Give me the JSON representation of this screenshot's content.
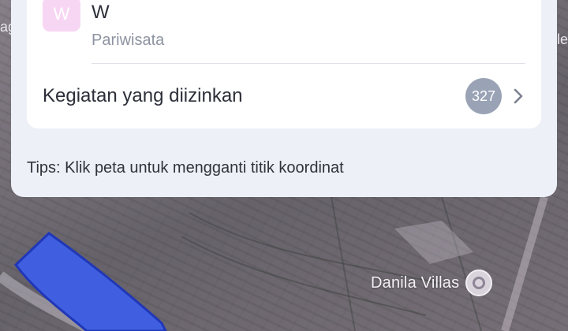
{
  "card": {
    "avatar_letter": "W",
    "title": "W",
    "subtitle": "Pariwisata"
  },
  "activities": {
    "label": "Kegiatan yang diizinkan",
    "count": "327"
  },
  "tips": "Tips: Klik peta untuk mengganti titik koordinat",
  "map": {
    "poi_name": "Danila Villas",
    "left_edge_text": "ag",
    "right_edge_text": "le",
    "polygon_color": "#3f5fe0"
  },
  "icons": {
    "chevron": "chevron-right-icon",
    "poi": "location-pin-icon"
  }
}
